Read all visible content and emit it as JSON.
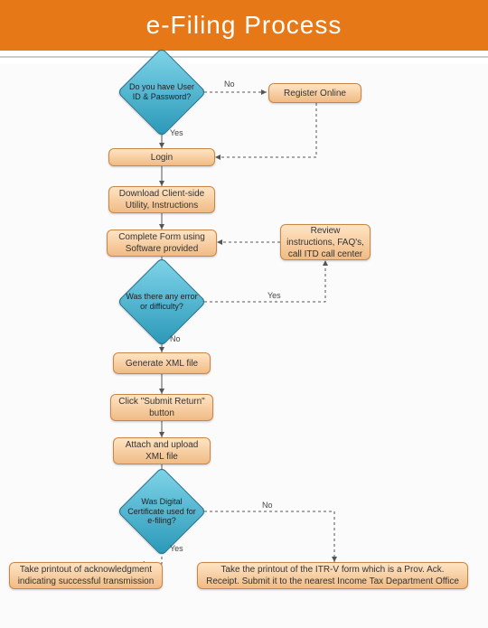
{
  "header": {
    "title": "e-Filing Process"
  },
  "nodes": {
    "decision_credentials": "Do you have User ID & Password?",
    "register": "Register Online",
    "login": "Login",
    "download": "Download Client-side Utility, Instructions",
    "complete_form": "Complete Form using Software provided",
    "review": "Review instructions, FAQ's, call ITD call center",
    "decision_error": "Was there any error or difficulty?",
    "generate_xml": "Generate XML file",
    "click_submit": "Click \"Submit Return\" button",
    "attach_upload": "Attach and upload XML file",
    "decision_dsc": "Was Digital Certificate used for e-filing?",
    "ack": "Take printout of acknowledgment indicating successful transmission",
    "itrv": "Take the printout of the ITR-V form which is a Prov. Ack. Receipt. Submit it to the nearest Income Tax Department Office"
  },
  "edges": {
    "yes": "Yes",
    "no": "No"
  },
  "colors": {
    "accent": "#e67817",
    "process": "#f0bb85",
    "decision": "#2a98b8"
  }
}
